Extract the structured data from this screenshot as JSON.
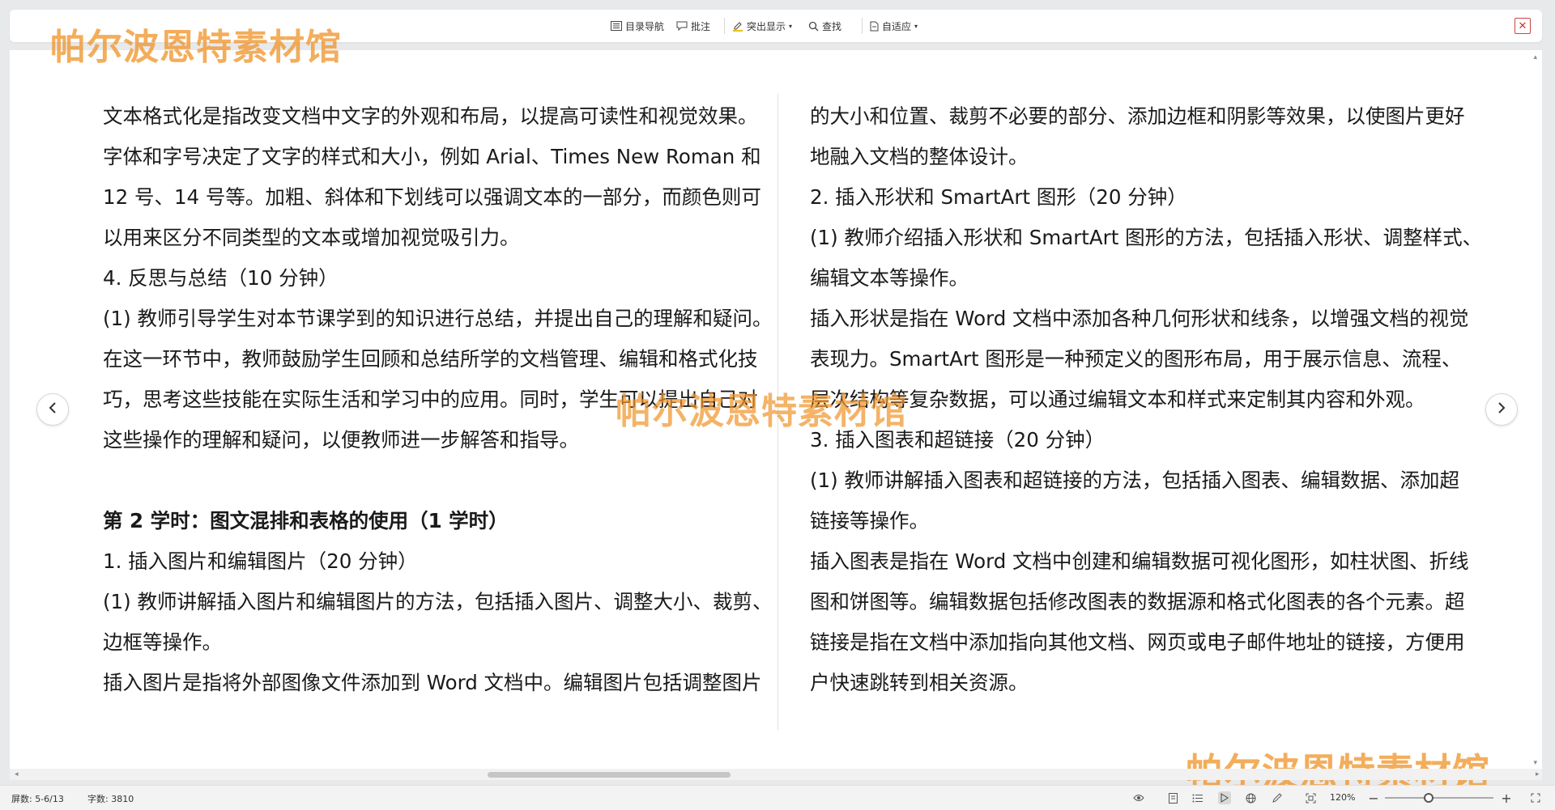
{
  "toolbar": {
    "toc": "目录导航",
    "comment": "批注",
    "highlight": "突出显示",
    "find": "查找",
    "fit": "自适应"
  },
  "watermark": "帕尔波恩特素材馆",
  "left_column": [
    "文本格式化是指改变文档中文字的外观和布局，以提高可读性和视觉效果。",
    "字体和字号决定了文字的样式和大小，例如 Arial、Times New Roman 和",
    "12 号、14 号等。加粗、斜体和下划线可以强调文本的一部分，而颜色则可",
    "以用来区分不同类型的文本或增加视觉吸引力。",
    "4. 反思与总结（10 分钟）",
    "(1) 教师引导学生对本节课学到的知识进行总结，并提出自己的理解和疑问。",
    "在这一环节中，教师鼓励学生回顾和总结所学的文档管理、编辑和格式化技",
    "巧，思考这些技能在实际生活和学习中的应用。同时，学生可以提出自己对",
    "这些操作的理解和疑问，以便教师进一步解答和指导。",
    "",
    "第 2 学时：图文混排和表格的使用（1 学时）",
    "1. 插入图片和编辑图片（20 分钟）",
    "(1) 教师讲解插入图片和编辑图片的方法，包括插入图片、调整大小、裁剪、",
    "边框等操作。",
    "插入图片是指将外部图像文件添加到 Word 文档中。编辑图片包括调整图片"
  ],
  "right_column": [
    "的大小和位置、裁剪不必要的部分、添加边框和阴影等效果，以使图片更好",
    "地融入文档的整体设计。",
    "2. 插入形状和 SmartArt 图形（20 分钟）",
    "(1) 教师介绍插入形状和 SmartArt 图形的方法，包括插入形状、调整样式、",
    "编辑文本等操作。",
    "插入形状是指在 Word 文档中添加各种几何形状和线条，以增强文档的视觉",
    "表现力。SmartArt 图形是一种预定义的图形布局，用于展示信息、流程、",
    "层次结构等复杂数据，可以通过编辑文本和样式来定制其内容和外观。",
    "3. 插入图表和超链接（20 分钟）",
    "(1) 教师讲解插入图表和超链接的方法，包括插入图表、编辑数据、添加超",
    "链接等操作。",
    "插入图表是指在 Word 文档中创建和编辑数据可视化图形，如柱状图、折线",
    "图和饼图等。编辑数据包括修改图表的数据源和格式化图表的各个元素。超",
    "链接是指在文档中添加指向其他文档、网页或电子邮件地址的链接，方便用",
    "户快速跳转到相关资源。"
  ],
  "status": {
    "pages": "屏数: 5-6/13",
    "words": "字数: 3810",
    "zoom": "120%"
  },
  "zoom_level": 0.4
}
